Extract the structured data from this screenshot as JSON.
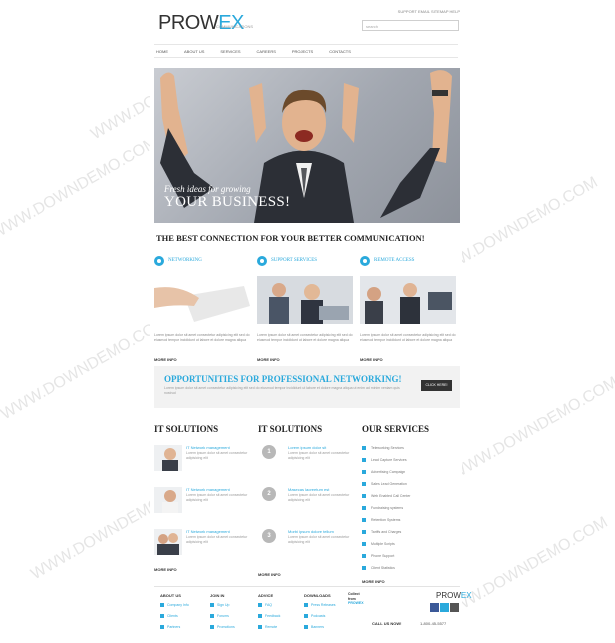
{
  "header": {
    "logo_main": "PROW",
    "logo_x": "EX",
    "logo_tagline": "COMMUNICATIONS",
    "top_links": "SUPPORT  EMAIL  SITEMAP  HELP",
    "search_placeholder": "search"
  },
  "nav": {
    "items": [
      "HOME",
      "ABOUT US",
      "SERVICES",
      "CAREERS",
      "PROJECTS",
      "CONTACTS"
    ]
  },
  "hero": {
    "line1": "Fresh ideas for growing",
    "line2": "YOUR BUSINESS!"
  },
  "headline": "THE BEST CONNECTION FOR YOUR BETTER COMMUNICATION!",
  "features": [
    {
      "title": "NETWORKING",
      "text": "Lorem ipsum dolor sit amet consectetur adipisicing elit sed do eiusmod tempor incididunt ut labore et dolore magna aliqua",
      "more": "MORE INFO"
    },
    {
      "title": "SUPPORT SERVICES",
      "text": "Lorem ipsum dolor sit amet consectetur adipisicing elit sed do eiusmod tempor incididunt ut labore et dolore magna aliqua",
      "more": "MORE INFO"
    },
    {
      "title": "REMOTE ACCESS",
      "text": "Lorem ipsum dolor sit amet consectetur adipisicing elit sed do eiusmod tempor incididunt ut labore et dolore magna aliqua",
      "more": "MORE INFO"
    }
  ],
  "banner": {
    "title": "OPPORTUNITIES FOR PROFESSIONAL NETWORKING!",
    "text": "Lorem ipsum dolor sit amet consectetur adipisicing elit sed do eiusmod tempor incididunt ut labore et dolore magna aliqua ut enim ad minim veniam quis nostrud",
    "button": "CLICK HERE!"
  },
  "col_a": {
    "heading": "IT SOLUTIONS",
    "items": [
      {
        "title": "IT Network management",
        "text": "Lorem ipsum dolor sit amet consectetur adipisicing elit"
      },
      {
        "title": "IT Network management",
        "text": "Lorem ipsum dolor sit amet consectetur adipisicing elit"
      },
      {
        "title": "IT Network management",
        "text": "Lorem ipsum dolor sit amet consectetur adipisicing elit"
      }
    ],
    "more": "MORE INFO"
  },
  "col_b": {
    "heading": "IT SOLUTIONS",
    "items": [
      {
        "num": "1",
        "title": "Lorem ipsum dolor sit",
        "text": "Lorem ipsum dolor sit amet consectetur adipisicing elit"
      },
      {
        "num": "2",
        "title": "Masecas laoreetum est",
        "text": "Lorem ipsum dolor sit amet consectetur adipisicing elit"
      },
      {
        "num": "3",
        "title": "Morbi ipsum dolore tellum",
        "text": "Lorem ipsum dolor sit amet consectetur adipisicing elit"
      }
    ],
    "more": "MORE INFO"
  },
  "col_c": {
    "heading": "OUR SERVICES",
    "items": [
      "Teleworking Services",
      "Lead Capture Services",
      "Advertising Campaign",
      "Sales Lead Generation",
      "Web Enabled Call Center",
      "Fundraising systems",
      "Retention Systems",
      "Tariffs and Charges",
      "Multiple Scripts",
      "Phone Support",
      "Client Statistics"
    ],
    "more": "MORE INFO"
  },
  "footer": {
    "columns": [
      {
        "heading": "ABOUT US",
        "links": [
          "Company Info",
          "Clients",
          "Partners"
        ]
      },
      {
        "heading": "JOIN IN",
        "links": [
          "Sign Up",
          "Forums",
          "Promotions"
        ]
      },
      {
        "heading": "ADVICE",
        "links": [
          "FAQ",
          "Feedback",
          "Remote"
        ]
      },
      {
        "heading": "DOWNLOADS",
        "links": [
          "Press Releases",
          "Podcasts",
          "Banners"
        ]
      }
    ],
    "collect_label": "Collect from",
    "collect_stub": "PROWEX",
    "logo_main": "PROW",
    "logo_x": "EX",
    "call_us": "CALL US NOW!",
    "phone": "1-800-45-5577"
  },
  "watermark": "WWW.DOWNDEMO.COM",
  "colors": {
    "accent": "#2aa9dc",
    "dark": "#333333"
  }
}
